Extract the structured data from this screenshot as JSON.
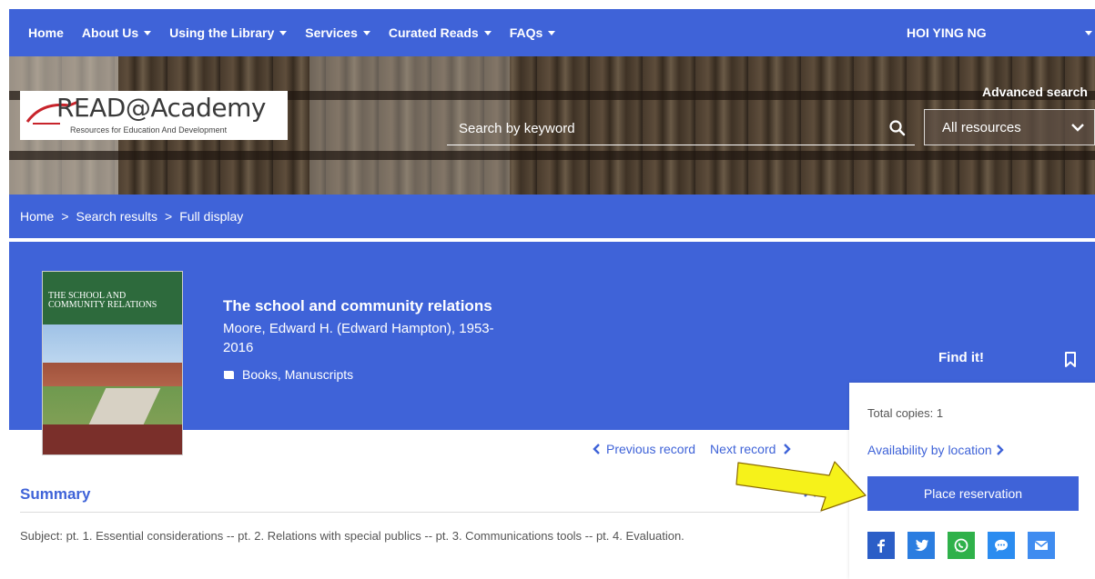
{
  "nav": {
    "items": [
      {
        "label": "Home",
        "dropdown": false
      },
      {
        "label": "About Us",
        "dropdown": true
      },
      {
        "label": "Using the Library",
        "dropdown": true
      },
      {
        "label": "Services",
        "dropdown": true
      },
      {
        "label": "Curated Reads",
        "dropdown": true
      },
      {
        "label": "FAQs",
        "dropdown": true
      }
    ],
    "user": "HOI YING NG"
  },
  "header": {
    "logo_text": "READ@Academy",
    "logo_tagline": "Resources for Education And Development",
    "search_placeholder": "Search by keyword",
    "scope_selected": "All resources",
    "advanced_search": "Advanced search"
  },
  "breadcrumb": {
    "items": [
      "Home",
      "Search results",
      "Full display"
    ],
    "separator": ">"
  },
  "record": {
    "cover_title": "THE SCHOOL AND COMMUNITY RELATIONS",
    "title": "The school and community relations",
    "author": "Moore, Edward H. (Edward Hampton), 1953-",
    "year": "2016",
    "type": "Books, Manuscripts",
    "type_icon": "book-icon"
  },
  "navigation": {
    "previous": "Previous record",
    "next": "Next record"
  },
  "summary": {
    "heading": "Summary",
    "text": "Subject: pt. 1. Essential considerations -- pt. 2. Relations with special publics -- pt. 3. Communications tools -- pt. 4. Evaluation."
  },
  "findit": {
    "heading": "Find it!",
    "total_copies": "Total copies: 1",
    "availability": "Availability by location",
    "reserve": "Place reservation"
  },
  "share": [
    {
      "name": "facebook-share-icon",
      "color": "#2b5ec7"
    },
    {
      "name": "twitter-share-icon",
      "color": "#2b7de0"
    },
    {
      "name": "whatsapp-share-icon",
      "color": "#2fb14a"
    },
    {
      "name": "messenger-share-icon",
      "color": "#2b8cf0"
    },
    {
      "name": "email-share-icon",
      "color": "#3f8cf0"
    }
  ],
  "colors": {
    "brand_blue": "#3f63d8",
    "annotation_arrow": "#f6f21a"
  }
}
